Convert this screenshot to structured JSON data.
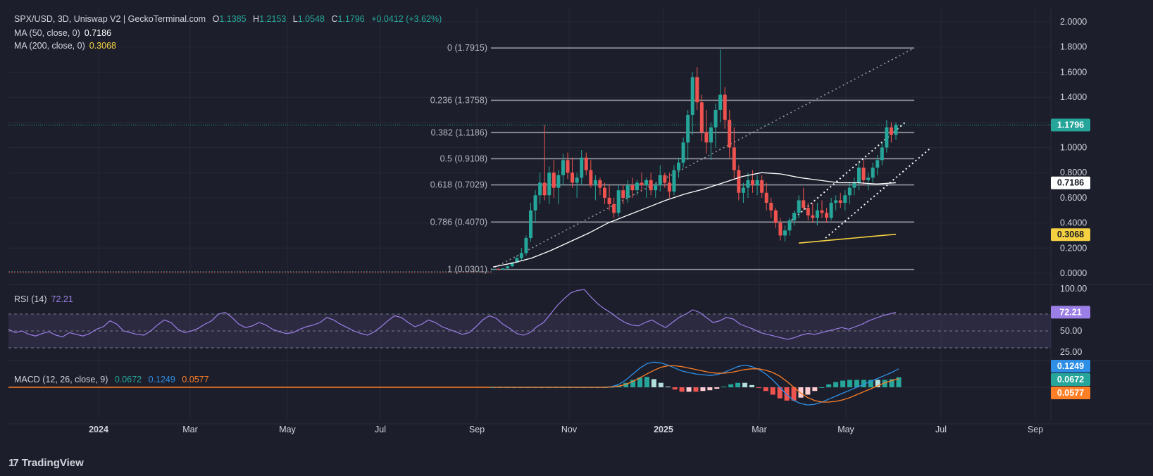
{
  "header": {
    "symbol": "SPX/USD, 3D, Uniswap V2 | GeckoTerminal.com",
    "o_label": "O",
    "o": "1.1385",
    "h_label": "H",
    "h": "1.2153",
    "l_label": "L",
    "l": "1.0548",
    "c_label": "C",
    "c": "1.1796",
    "change": "+0.0412 (+3.62%)"
  },
  "ma50": {
    "label": "MA (50, close, 0)",
    "value": "0.7186"
  },
  "ma200": {
    "label": "MA (200, close, 0)",
    "value": "0.3068"
  },
  "rsi": {
    "label": "RSI (14)",
    "value": "72.21"
  },
  "macd": {
    "label": "MACD (12, 26, close, 9)",
    "v1": "0.0672",
    "v2": "0.1249",
    "v3": "0.0577"
  },
  "brand": {
    "logo": "17",
    "name": "TradingView"
  },
  "colors": {
    "bg": "#1c1f2b",
    "up": "#26a69a",
    "down": "#ef5350",
    "ma50": "#ffffff",
    "ma200": "#f5d142",
    "rsi": "#9c7fe6",
    "macd": "#2f8ee6",
    "signal": "#ff7f27"
  },
  "chart_data": [
    {
      "type": "candlestick",
      "title": "SPX/USD, 3D, Uniswap V2",
      "y_ticks": [
        "0.0000",
        "0.2000",
        "0.4000",
        "0.6000",
        "0.8000",
        "1.0000",
        "1.2000",
        "1.4000",
        "1.6000",
        "1.8000",
        "2.0000"
      ],
      "ylim": [
        0,
        2.0
      ],
      "x_ticks": [
        "2024",
        "Mar",
        "May",
        "Jul",
        "Sep",
        "Nov",
        "2025",
        "Mar",
        "May",
        "Jul",
        "Sep"
      ],
      "last_price": "1.1796",
      "ma50_tag": "0.7186",
      "ma200_tag": "0.3068",
      "fib_levels": [
        {
          "label": "0 (1.7915)",
          "value": 1.7915
        },
        {
          "label": "0.236 (1.3758)",
          "value": 1.3758
        },
        {
          "label": "0.382 (1.1186)",
          "value": 1.1186
        },
        {
          "label": "0.5 (0.9108)",
          "value": 0.9108
        },
        {
          "label": "0.618 (0.7029)",
          "value": 0.7029
        },
        {
          "label": "0.786 (0.4070)",
          "value": 0.407
        },
        {
          "label": "1 (0.0301)",
          "value": 0.0301
        }
      ],
      "candles_ohlc": [
        [
          0.03,
          0.035,
          0.025,
          0.032
        ],
        [
          0.032,
          0.04,
          0.028,
          0.03
        ],
        [
          0.03,
          0.04,
          0.028,
          0.038
        ],
        [
          0.038,
          0.06,
          0.035,
          0.055
        ],
        [
          0.055,
          0.09,
          0.05,
          0.085
        ],
        [
          0.085,
          0.14,
          0.08,
          0.12
        ],
        [
          0.12,
          0.2,
          0.1,
          0.16
        ],
        [
          0.16,
          0.3,
          0.14,
          0.28
        ],
        [
          0.28,
          0.56,
          0.25,
          0.5
        ],
        [
          0.5,
          0.66,
          0.4,
          0.62
        ],
        [
          0.62,
          0.8,
          0.55,
          0.72
        ],
        [
          0.72,
          1.18,
          0.58,
          0.62
        ],
        [
          0.62,
          0.85,
          0.55,
          0.8
        ],
        [
          0.8,
          0.9,
          0.6,
          0.68
        ],
        [
          0.68,
          0.82,
          0.55,
          0.78
        ],
        [
          0.78,
          0.95,
          0.7,
          0.9
        ],
        [
          0.9,
          0.96,
          0.75,
          0.8
        ],
        [
          0.8,
          0.92,
          0.68,
          0.72
        ],
        [
          0.72,
          0.8,
          0.6,
          0.76
        ],
        [
          0.76,
          0.98,
          0.7,
          0.92
        ],
        [
          0.92,
          0.96,
          0.78,
          0.82
        ],
        [
          0.82,
          0.9,
          0.68,
          0.7
        ],
        [
          0.7,
          0.78,
          0.58,
          0.74
        ],
        [
          0.74,
          0.76,
          0.62,
          0.68
        ],
        [
          0.68,
          0.72,
          0.55,
          0.6
        ],
        [
          0.6,
          0.7,
          0.5,
          0.55
        ],
        [
          0.55,
          0.6,
          0.44,
          0.48
        ],
        [
          0.48,
          0.7,
          0.45,
          0.66
        ],
        [
          0.66,
          0.7,
          0.55,
          0.6
        ],
        [
          0.6,
          0.74,
          0.56,
          0.7
        ],
        [
          0.7,
          0.76,
          0.6,
          0.66
        ],
        [
          0.66,
          0.74,
          0.62,
          0.72
        ],
        [
          0.72,
          0.8,
          0.65,
          0.7
        ],
        [
          0.7,
          0.76,
          0.6,
          0.74
        ],
        [
          0.74,
          0.8,
          0.62,
          0.66
        ],
        [
          0.66,
          0.72,
          0.6,
          0.7
        ],
        [
          0.7,
          0.86,
          0.65,
          0.78
        ],
        [
          0.78,
          0.8,
          0.68,
          0.72
        ],
        [
          0.72,
          0.8,
          0.6,
          0.65
        ],
        [
          0.65,
          0.86,
          0.62,
          0.82
        ],
        [
          0.82,
          0.92,
          0.76,
          0.88
        ],
        [
          0.88,
          1.08,
          0.84,
          1.04
        ],
        [
          1.04,
          1.3,
          0.9,
          1.26
        ],
        [
          1.26,
          1.6,
          1.1,
          1.56
        ],
        [
          1.56,
          1.64,
          1.3,
          1.36
        ],
        [
          1.36,
          1.42,
          1.05,
          1.12
        ],
        [
          1.12,
          1.3,
          0.95,
          1.04
        ],
        [
          1.04,
          1.2,
          0.9,
          1.16
        ],
        [
          1.16,
          1.35,
          1.0,
          1.3
        ],
        [
          1.3,
          1.78,
          1.2,
          1.42
        ],
        [
          1.42,
          1.48,
          1.15,
          1.22
        ],
        [
          1.22,
          1.3,
          0.92,
          1.0
        ],
        [
          1.0,
          1.16,
          0.75,
          0.82
        ],
        [
          0.82,
          0.86,
          0.58,
          0.64
        ],
        [
          0.64,
          0.72,
          0.56,
          0.68
        ],
        [
          0.68,
          0.8,
          0.6,
          0.74
        ],
        [
          0.74,
          0.82,
          0.64,
          0.7
        ],
        [
          0.7,
          0.78,
          0.62,
          0.74
        ],
        [
          0.74,
          0.78,
          0.6,
          0.64
        ],
        [
          0.64,
          0.72,
          0.5,
          0.56
        ],
        [
          0.56,
          0.6,
          0.44,
          0.5
        ],
        [
          0.5,
          0.52,
          0.36,
          0.4
        ],
        [
          0.4,
          0.44,
          0.26,
          0.3
        ],
        [
          0.3,
          0.38,
          0.25,
          0.34
        ],
        [
          0.34,
          0.44,
          0.3,
          0.42
        ],
        [
          0.42,
          0.5,
          0.38,
          0.48
        ],
        [
          0.48,
          0.62,
          0.44,
          0.58
        ],
        [
          0.58,
          0.68,
          0.5,
          0.52
        ],
        [
          0.52,
          0.56,
          0.42,
          0.46
        ],
        [
          0.46,
          0.56,
          0.4,
          0.44
        ],
        [
          0.44,
          0.56,
          0.38,
          0.5
        ],
        [
          0.5,
          0.58,
          0.44,
          0.48
        ],
        [
          0.48,
          0.52,
          0.4,
          0.44
        ],
        [
          0.44,
          0.6,
          0.42,
          0.56
        ],
        [
          0.56,
          0.62,
          0.5,
          0.58
        ],
        [
          0.58,
          0.64,
          0.52,
          0.56
        ],
        [
          0.56,
          0.66,
          0.5,
          0.62
        ],
        [
          0.62,
          0.72,
          0.55,
          0.68
        ],
        [
          0.68,
          0.76,
          0.62,
          0.72
        ],
        [
          0.72,
          0.88,
          0.66,
          0.84
        ],
        [
          0.84,
          0.9,
          0.7,
          0.74
        ],
        [
          0.74,
          0.8,
          0.66,
          0.76
        ],
        [
          0.76,
          0.88,
          0.72,
          0.84
        ],
        [
          0.84,
          0.94,
          0.78,
          0.9
        ],
        [
          0.9,
          1.04,
          0.86,
          1.0
        ],
        [
          1.0,
          1.22,
          0.96,
          1.16
        ],
        [
          1.16,
          1.2,
          1.04,
          1.1
        ],
        [
          1.1,
          1.2,
          1.06,
          1.18
        ]
      ],
      "candle_dates": [
        "2024-09-03",
        "2024-12-31",
        "2025-06-03"
      ],
      "ma50_series": [
        0.05,
        0.08,
        0.12,
        0.18,
        0.25,
        0.32,
        0.4,
        0.46,
        0.52,
        0.58,
        0.63,
        0.67,
        0.72,
        0.77,
        0.8,
        0.79,
        0.76,
        0.74,
        0.72,
        0.72,
        0.71,
        0.72
      ],
      "ma200_series": [
        0.24,
        0.25,
        0.26,
        0.27,
        0.28,
        0.29,
        0.3,
        0.31
      ]
    },
    {
      "type": "line",
      "title": "RSI (14)",
      "y_ticks": [
        "25.00",
        "50.00",
        "100.00"
      ],
      "ylim": [
        20,
        100
      ],
      "bands": [
        30,
        50,
        70
      ],
      "last": "72.21",
      "values": [
        52,
        48,
        50,
        46,
        44,
        47,
        49,
        45,
        43,
        48,
        46,
        44,
        47,
        52,
        55,
        62,
        58,
        50,
        48,
        46,
        45,
        50,
        57,
        63,
        60,
        52,
        48,
        50,
        53,
        58,
        62,
        70,
        72,
        66,
        58,
        54,
        56,
        60,
        57,
        52,
        49,
        47,
        48,
        52,
        55,
        57,
        60,
        66,
        63,
        58,
        54,
        50,
        47,
        45,
        49,
        55,
        62,
        68,
        66,
        60,
        55,
        58,
        63,
        60,
        55,
        52,
        49,
        46,
        48,
        55,
        63,
        68,
        65,
        58,
        53,
        47,
        45,
        48,
        55,
        60,
        70,
        80,
        88,
        95,
        98,
        99,
        90,
        82,
        76,
        71,
        65,
        60,
        57,
        56,
        60,
        63,
        58,
        54,
        60,
        66,
        70,
        75,
        72,
        66,
        60,
        62,
        66,
        64,
        58,
        55,
        52,
        48,
        46,
        44,
        42,
        40,
        42,
        45,
        47,
        46,
        48,
        50,
        52,
        54,
        52,
        55,
        58,
        62,
        65,
        68,
        70,
        72
      ]
    },
    {
      "type": "histogram",
      "title": "MACD (12, 26, close, 9)",
      "last_macd": "0.1249",
      "last_signal": "0.0577",
      "last_hist": "0.0672",
      "macd": [
        0,
        0,
        0,
        0,
        0,
        0,
        0,
        0,
        0,
        0,
        0,
        0,
        0,
        0,
        0,
        0,
        0,
        0.005,
        0.02,
        0.05,
        0.09,
        0.13,
        0.16,
        0.17,
        0.165,
        0.15,
        0.13,
        0.11,
        0.1,
        0.09,
        0.085,
        0.08,
        0.085,
        0.1,
        0.12,
        0.14,
        0.15,
        0.14,
        0.12,
        0.09,
        0.05,
        0.0,
        -0.05,
        -0.09,
        -0.11,
        -0.12,
        -0.115,
        -0.1,
        -0.08,
        -0.06,
        -0.04,
        -0.02,
        0.0,
        0.02,
        0.04,
        0.06,
        0.08,
        0.1,
        0.1249
      ],
      "signal": [
        0,
        0,
        0,
        0,
        0,
        0,
        0,
        0,
        0,
        0,
        0,
        0,
        0,
        0,
        0,
        0,
        0,
        0.002,
        0.008,
        0.02,
        0.04,
        0.065,
        0.09,
        0.115,
        0.135,
        0.145,
        0.145,
        0.14,
        0.13,
        0.12,
        0.11,
        0.1,
        0.095,
        0.095,
        0.1,
        0.11,
        0.12,
        0.125,
        0.125,
        0.115,
        0.1,
        0.075,
        0.04,
        0.0,
        -0.04,
        -0.07,
        -0.09,
        -0.1,
        -0.1,
        -0.095,
        -0.085,
        -0.07,
        -0.05,
        -0.03,
        -0.01,
        0.01,
        0.03,
        0.045,
        0.0577
      ]
    }
  ]
}
